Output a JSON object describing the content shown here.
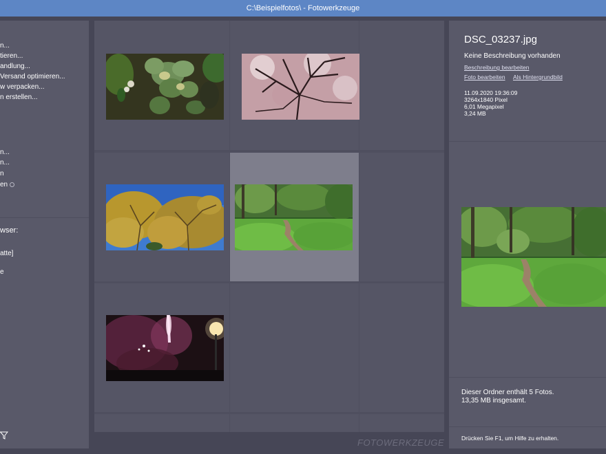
{
  "window": {
    "title": "C:\\Beispielfotos\\ - Fotowerkzeuge"
  },
  "left_menu": {
    "items": [
      {
        "label": "n..."
      },
      {
        "label": "tieren..."
      },
      {
        "label": "andlung..."
      },
      {
        "label": "Versand optimieren..."
      },
      {
        "label": "w verpacken..."
      },
      {
        "label": "n erstellen..."
      },
      {
        "label": "n..."
      },
      {
        "label": "n..."
      },
      {
        "label": "n"
      },
      {
        "label": "en"
      }
    ],
    "browser_heading": "wser:",
    "browser_items": [
      {
        "label": "atte]"
      },
      {
        "label": "e"
      }
    ]
  },
  "grid": {
    "columns": 3,
    "photos": [
      {
        "name": "hosta-leaves-photo"
      },
      {
        "name": "cherry-blossom-tree-photo"
      },
      {
        "name": "yellow-autumn-trees-photo"
      },
      {
        "name": "forest-path-photo",
        "selected": true
      },
      {
        "name": "fireworks-night-photo"
      }
    ]
  },
  "watermark": "FOTOWERKZEUGE",
  "details": {
    "file_name": "DSC_03237.jpg",
    "description": "Keine Beschreibung vorhanden",
    "edit_description_link": "Beschreibung bearbeiten",
    "edit_photo_link": "Foto bearbeiten",
    "wallpaper_link": "Als Hintergrundbild",
    "date": "11.09.2020 19:36:09",
    "dimensions": "3264x1840 Pixel",
    "megapixel": "6,01 Megapixel",
    "size": "3,24 MB"
  },
  "summary": {
    "line1": "Dieser Ordner enthält 5 Fotos.",
    "line2": "13,35 MB insgesamt."
  },
  "help": "Drücken Sie F1, um Hilfe zu erhalten."
}
